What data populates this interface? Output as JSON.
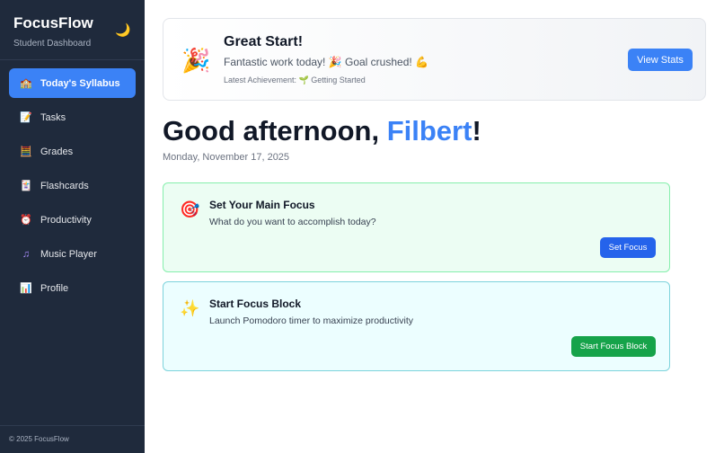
{
  "sidebar": {
    "brand": "FocusFlow",
    "subtitle": "Student Dashboard",
    "theme_icon": "moon-icon",
    "items": [
      {
        "label": "Today's Syllabus",
        "icon": "house-icon",
        "active": true
      },
      {
        "label": "Tasks",
        "icon": "memo-icon"
      },
      {
        "label": "Grades",
        "icon": "abacus-icon"
      },
      {
        "label": "Flashcards",
        "icon": "cards-icon"
      },
      {
        "label": "Productivity",
        "icon": "alarm-clock-icon"
      },
      {
        "label": "Music Player",
        "icon": "music-note-icon"
      },
      {
        "label": "Profile",
        "icon": "bar-chart-icon"
      }
    ],
    "footer": "© 2025 FocusFlow"
  },
  "banner": {
    "icon": "party-popper-icon",
    "title": "Great Start!",
    "text": "Fantastic work today! 🎉 Goal crushed! 💪",
    "achievement": "Latest Achievement: 🌱 Getting Started",
    "button": "View Stats"
  },
  "greeting": {
    "prefix": "Good afternoon, ",
    "name": "Filbert",
    "suffix": "!",
    "date": "Monday, November 17, 2025"
  },
  "cards": [
    {
      "icon": "target-icon",
      "title": "Set Your Main Focus",
      "subtitle": "What do you want to accomplish today?",
      "button": "Set Focus"
    },
    {
      "icon": "sparkles-icon",
      "title": "Start Focus Block",
      "subtitle": "Launch Pomodoro timer to maximize productivity",
      "button": "Start Focus Block"
    }
  ],
  "colors": {
    "sidebar_bg": "#1f2a3c",
    "accent": "#3b82f6",
    "success": "#16a34a"
  }
}
